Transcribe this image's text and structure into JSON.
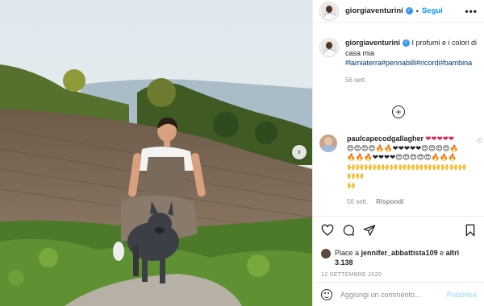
{
  "post": {
    "author": "giorgiaventurini",
    "follow_label": "Segui",
    "more_label": "•••",
    "dot": "•"
  },
  "caption": {
    "author": "giorgiaventurini",
    "text": "I profumi e i colori di casa mia",
    "hashtags": "#lamiaterra#pennabilli#ricordi#bambina",
    "time": "56 sett."
  },
  "comment": {
    "author": "paulcapecodgallagher",
    "line1": "❤❤❤❤❤",
    "line2": "😍😍😍😍🔥🔥❤❤❤❤❤😍😍😍😍🔥",
    "line3": "🔥🔥🔥❤❤❤❤😍😍😍😍😍🔥🔥🔥",
    "line4": "🙌🙌🙌🙌🙌🙌🙌🙌🙌🙌🙌🙌🙌🙌🙌🙌",
    "line5": "🙌",
    "time": "56 sett.",
    "reply_label": "Rispondi"
  },
  "likes": {
    "prefix": "Piace a",
    "user": "jennifer_abbattista109",
    "conj": "e",
    "others": "altri 3.138"
  },
  "date": "12 SETTEMBRE 2020",
  "composer": {
    "placeholder": "Aggiungi un commento...",
    "publish_label": "Pubblica"
  },
  "colors": {
    "link": "#0095f6",
    "hashtag": "#00376b",
    "muted": "#8e8e8e"
  }
}
